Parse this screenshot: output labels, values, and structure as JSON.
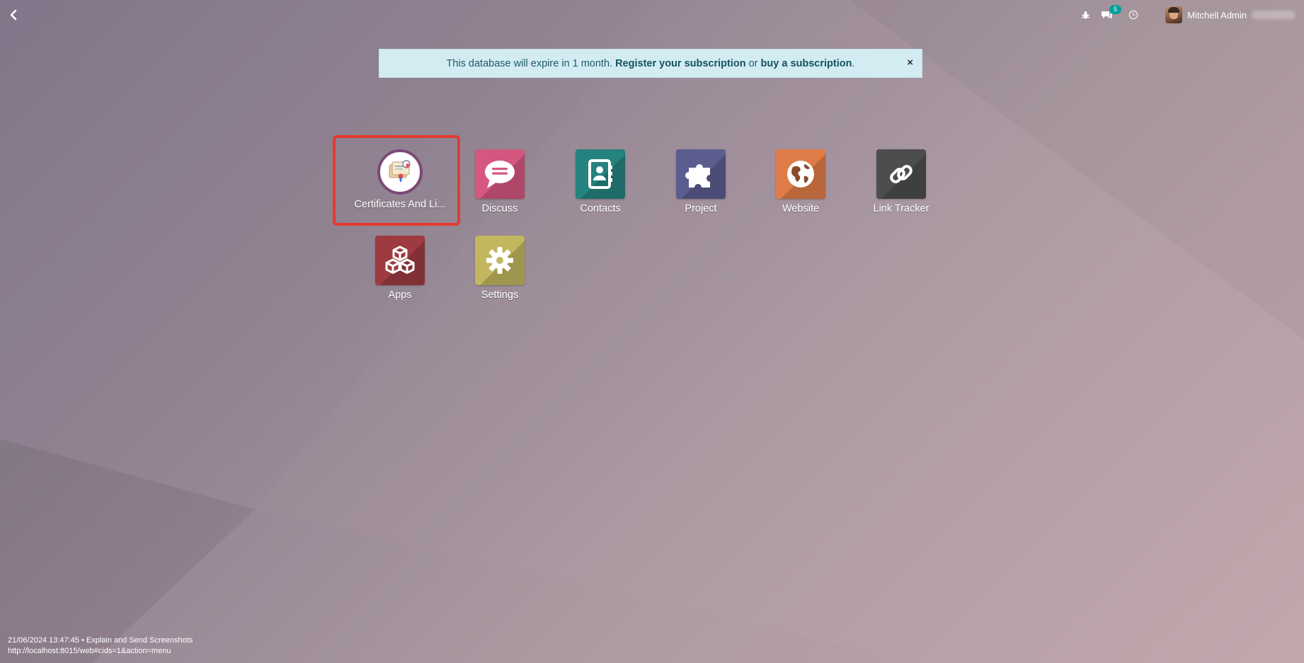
{
  "topbar": {
    "back_icon": "chevron-left-icon",
    "systray": {
      "debug_icon": "bug-icon",
      "messages_icon": "chat-bubbles-icon",
      "messages_count": "5",
      "activity_icon": "clock-icon",
      "user_name": "Mitchell Admin"
    }
  },
  "alert": {
    "text_before": "This database will expire in 1 month. ",
    "register_link": "Register your subscription",
    "text_middle": " or ",
    "buy_link": "buy a subscription",
    "text_after": ".",
    "close_label": "×"
  },
  "apps": [
    {
      "label": "Certificates And Li...",
      "icon": "certificate-icon",
      "color": "#7b4a76"
    },
    {
      "label": "Discuss",
      "icon": "speech-bubble-icon",
      "color": "#d4577f"
    },
    {
      "label": "Contacts",
      "icon": "address-book-icon",
      "color": "#24827f"
    },
    {
      "label": "Project",
      "icon": "puzzle-icon",
      "color": "#5b5d8f"
    },
    {
      "label": "Website",
      "icon": "globe-icon",
      "color": "#e07c47"
    },
    {
      "label": "Link Tracker",
      "icon": "link-icon",
      "color": "#4d4d4d"
    },
    {
      "label": "Apps",
      "icon": "cubes-icon",
      "color": "#9d3b41"
    },
    {
      "label": "Settings",
      "icon": "gear-icon",
      "color": "#c2b75e"
    }
  ],
  "footer": {
    "line1": "21/06/2024 13:47:45 • Explain and Send Screenshots",
    "line2": "http://localhost:8015/web#cids=1&action=menu"
  }
}
